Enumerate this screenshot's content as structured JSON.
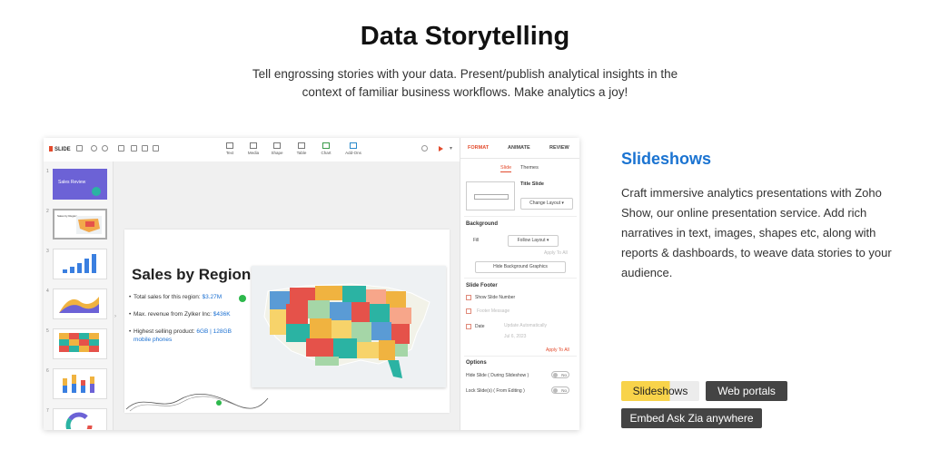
{
  "hero": {
    "title": "Data Storytelling",
    "subtitle": "Tell engrossing stories with your data. Present/publish analytical insights in the context of familiar business workflows. Make analytics a joy!"
  },
  "app": {
    "logo": "SLIDE",
    "toolbar_items": [
      "Text",
      "Media",
      "Shape",
      "Table",
      "Chart",
      "Add-Ons"
    ],
    "thumbnails": {
      "numbers": [
        "1",
        "2",
        "3",
        "4",
        "5",
        "6",
        "7"
      ],
      "first_title": "Sales Review"
    },
    "slide": {
      "title": "Sales by Region",
      "bullets": [
        {
          "text": "Total sales for this region: ",
          "value": "$3.27M"
        },
        {
          "text": "Max. revenue from Zylker Inc: ",
          "value": "$436K"
        },
        {
          "text": "Highest selling product: ",
          "value": "6GB | 128GB mobile phones"
        }
      ]
    },
    "panel": {
      "tabs": [
        "FORMAT",
        "ANIMATE",
        "REVIEW"
      ],
      "subtabs": [
        "Slide",
        "Themes"
      ],
      "title_slide_label": "Title Slide",
      "change_layout": "Change Layout",
      "background_label": "Background",
      "fill_label": "Fill",
      "fill_value": "Follow Layout",
      "apply_to_all_faded": "Apply To All",
      "hide_background": "Hide Background Graphics",
      "slide_footer_label": "Slide Footer",
      "show_slide_number": "Show Slide Number",
      "footer_message": "Footer Message",
      "date_label": "Date",
      "date_placeholder": "Update Automatically",
      "date_value": "Jul 6, 2023",
      "apply_to_all": "Apply To All",
      "options_label": "Options",
      "hide_slide": "Hide Slide ( During Slideshow )",
      "lock_slide": "Lock Slide(s) ( From Editing )",
      "toggle_off": "No"
    }
  },
  "section": {
    "title": "Slideshows",
    "body": "Craft immersive analytics presentations with Zoho Show, our online presentation service. Add rich narratives in text, images, shapes etc, along with reports & dashboards, to weave data stories to your audience."
  },
  "chips": [
    "Slideshows",
    "Web portals",
    "Embed Ask Zia anywhere"
  ],
  "colors": {
    "accent_blue": "#1a73d1",
    "accent_yellow": "#f8d34a",
    "chip_dark": "#444444",
    "brand_red": "#e34b2d"
  }
}
